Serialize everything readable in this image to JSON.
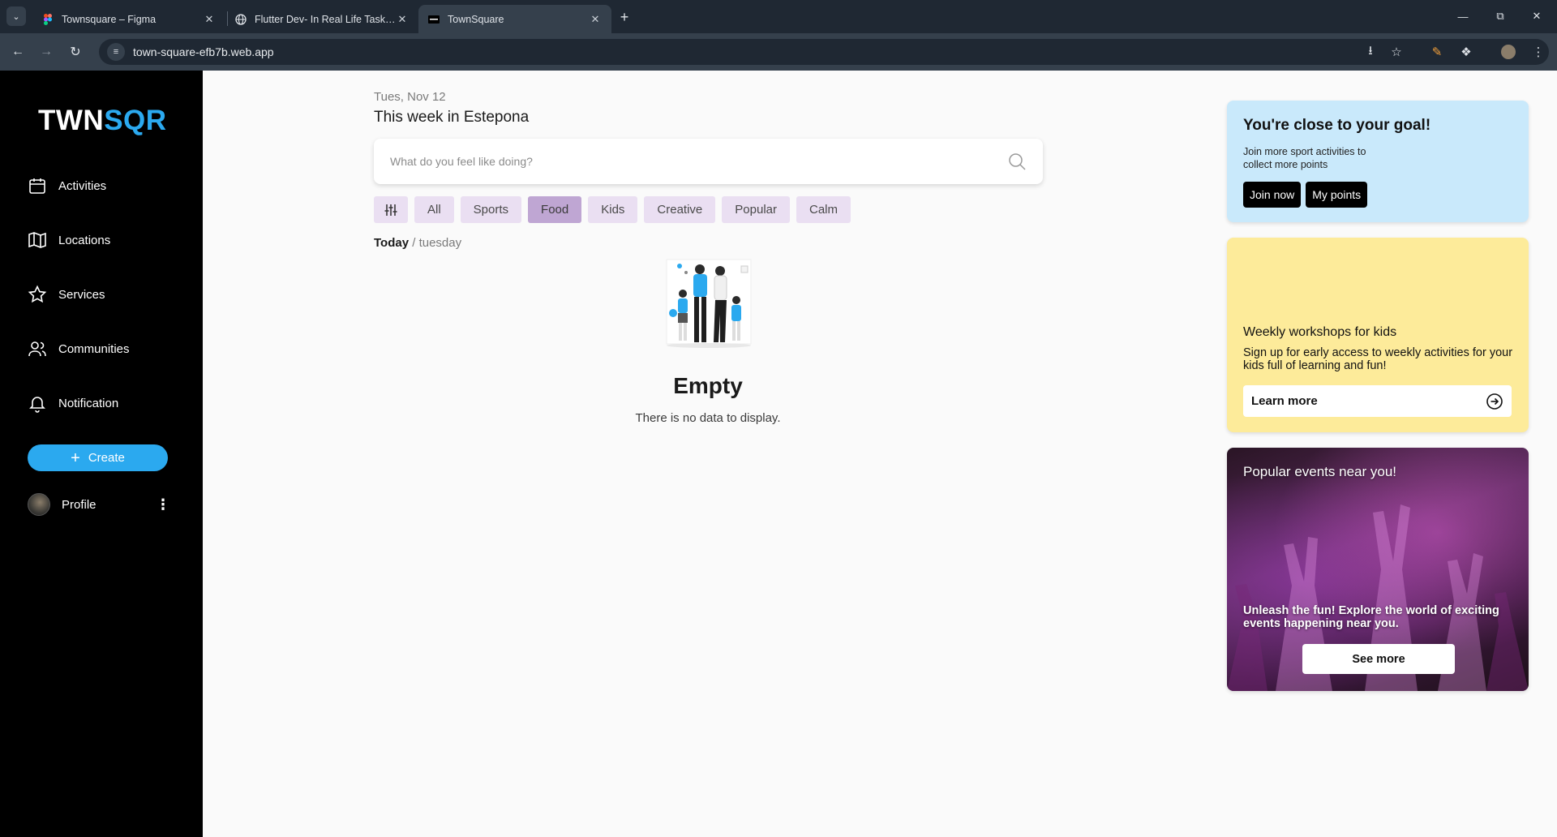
{
  "browser": {
    "tabs": [
      {
        "title": "Townsquare – Figma",
        "active": false
      },
      {
        "title": "Flutter Dev- In Real Life Task Nu",
        "active": false
      },
      {
        "title": "TownSquare",
        "active": true
      }
    ],
    "url": "town-square-efb7b.web.app",
    "colors": {
      "tabbar": "#1f2833",
      "toolbar": "#35404c"
    }
  },
  "app": {
    "logo": {
      "part1": "TWN",
      "part2": "SQR"
    },
    "brand_color": "#2ba9ef",
    "nav": [
      {
        "label": "Activities",
        "icon": "calendar-icon"
      },
      {
        "label": "Locations",
        "icon": "map-icon"
      },
      {
        "label": "Services",
        "icon": "star-icon"
      },
      {
        "label": "Communities",
        "icon": "users-icon"
      },
      {
        "label": "Notification",
        "icon": "bell-icon"
      }
    ],
    "create_label": "Create",
    "profile_label": "Profile"
  },
  "main": {
    "date": "Tues, Nov 12",
    "heading": "This week in Estepona",
    "search_placeholder": "What do you feel like doing?",
    "chips": [
      {
        "label": "All",
        "active": false
      },
      {
        "label": "Sports",
        "active": false
      },
      {
        "label": "Food",
        "active": true
      },
      {
        "label": "Kids",
        "active": false
      },
      {
        "label": "Creative",
        "active": false
      },
      {
        "label": "Popular",
        "active": false
      },
      {
        "label": "Calm",
        "active": false
      }
    ],
    "day_today": "Today",
    "day_rest": " / tuesday",
    "empty_title": "Empty",
    "empty_sub": "There is no data to display."
  },
  "cards": {
    "goal": {
      "title": "You're close to your goal!",
      "subtitle": "Join more sport activities to collect more points",
      "join_label": "Join now",
      "points_label": "My points"
    },
    "kids": {
      "title": "Weekly workshops for kids",
      "subtitle": "Sign up for early access to weekly activities for your kids full of learning and fun!",
      "cta": "Learn more"
    },
    "events": {
      "title": "Popular events near you!",
      "subtitle": "Unleash the fun! Explore the world of exciting events happening near you.",
      "cta": "See more"
    }
  }
}
